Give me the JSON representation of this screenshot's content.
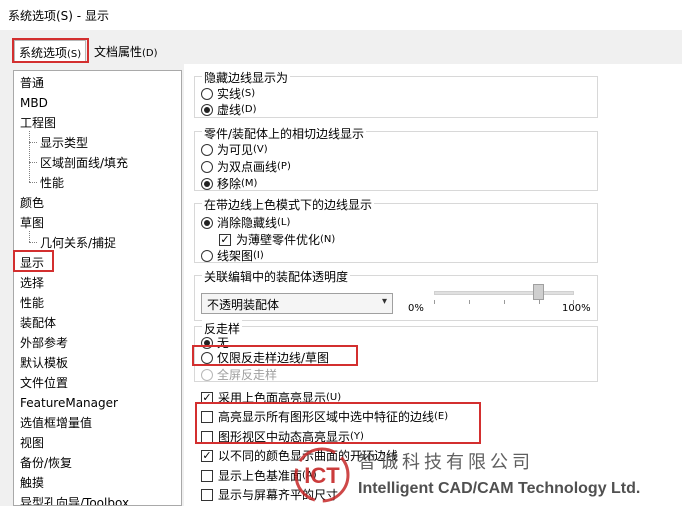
{
  "window": {
    "title": "系统选项(S) - 显示"
  },
  "tabs": [
    {
      "label": "系统选项",
      "key": "(S)"
    },
    {
      "label": "文档属性",
      "key": "(D)"
    }
  ],
  "tree": {
    "items": [
      "普通",
      "MBD",
      "工程图",
      "显示类型",
      "区域剖面线/填充",
      "性能",
      "颜色",
      "草图",
      "几何关系/捕捉",
      "显示",
      "选择",
      "性能",
      "装配体",
      "外部参考",
      "默认模板",
      "文件位置",
      "FeatureManager",
      "选值框增量值",
      "视图",
      "备份/恢复",
      "触摸",
      "异型孔向导/Toolbox"
    ]
  },
  "hidden_edges": {
    "title": "隐藏边线显示为",
    "options": [
      {
        "label": "实线",
        "key": "(S)",
        "selected": false
      },
      {
        "label": "虚线",
        "key": "(D)",
        "selected": true
      }
    ]
  },
  "tangent_edges": {
    "title": "零件/装配体上的相切边线显示",
    "options": [
      {
        "label": "为可见",
        "key": "(V)",
        "selected": false
      },
      {
        "label": "为双点画线",
        "key": "(P)",
        "selected": false
      },
      {
        "label": "移除",
        "key": "(M)",
        "selected": true
      }
    ]
  },
  "shaded_edges": {
    "title": "在带边线上色模式下的边线显示",
    "remove_hidden": {
      "label": "消除隐藏线",
      "key": "(L)",
      "selected": true
    },
    "thin_wall": {
      "label": "为薄壁零件优化",
      "key": "(N)",
      "checked": true
    },
    "wireframe": {
      "label": "线架图",
      "key": "(I)",
      "selected": false
    }
  },
  "transparency": {
    "title": "关联编辑中的装配体透明度",
    "combo_value": "不透明装配体",
    "min_label": "0%",
    "max_label": "100%",
    "slider_fraction": 0.75
  },
  "antialias": {
    "title": "反走样",
    "options": [
      {
        "label": "无",
        "key": "",
        "selected": true,
        "disabled": false
      },
      {
        "label": "仅限反走样边线/草图",
        "key": "",
        "selected": false,
        "disabled": false
      },
      {
        "label": "全屏反走样",
        "key": "",
        "selected": false,
        "disabled": true
      }
    ]
  },
  "checkboxes": [
    {
      "label": "采用上色面高亮显示",
      "key": "(U)",
      "checked": true
    },
    {
      "label": "高亮显示所有图形区域中选中特征的边线",
      "key": "(E)",
      "checked": false
    },
    {
      "label": "图形视区中动态高亮显示",
      "key": "(Y)",
      "checked": false
    },
    {
      "label": "以不同的颜色显示曲面的开环边线",
      "key": "",
      "checked": true
    },
    {
      "label": "显示上色基准面",
      "key": "(A)",
      "checked": false
    },
    {
      "label": "显示与屏幕齐平的尺寸",
      "key": "",
      "checked": false
    }
  ],
  "watermark": {
    "logo_text": "ICT",
    "cn": "智诚科技有限公司",
    "en": "Intelligent CAD/CAM Technology Ltd."
  },
  "colors": {
    "highlight": "#d32f2f",
    "logo": "#c62828"
  }
}
